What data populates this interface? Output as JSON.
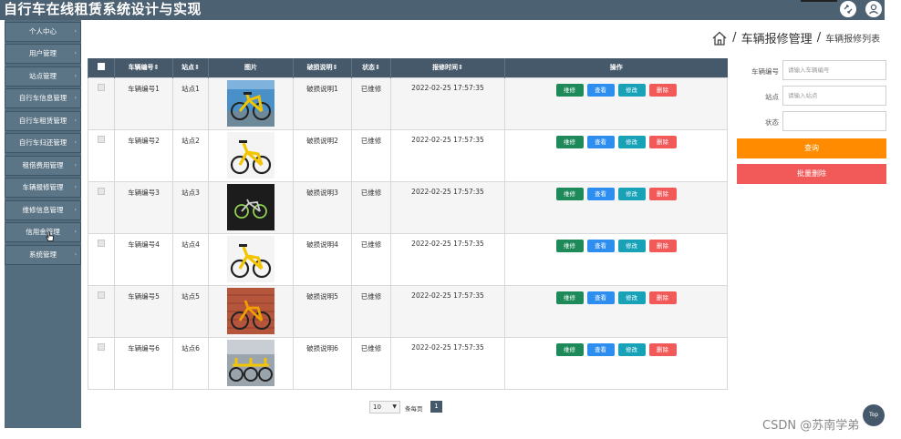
{
  "app": {
    "title": "自行车在线租赁系统设计与实现",
    "header_icons": [
      "fullscreen-exit-icon",
      "user-icon"
    ]
  },
  "sidebar": {
    "items": [
      {
        "label": "个人中心"
      },
      {
        "label": "用户管理"
      },
      {
        "label": "站点管理"
      },
      {
        "label": "自行车信息管理"
      },
      {
        "label": "自行车租赁管理"
      },
      {
        "label": "自行车归还管理"
      },
      {
        "label": "租借费用管理"
      },
      {
        "label": "车辆报修管理"
      },
      {
        "label": "维修信息管理"
      },
      {
        "label": "信用金管理"
      },
      {
        "label": "系统管理"
      }
    ]
  },
  "breadcrumb": {
    "section": "车辆报修管理",
    "separator": "/",
    "page": "车辆报修列表"
  },
  "table": {
    "columns": [
      "车辆编号",
      "站点",
      "图片",
      "破损说明",
      "状态",
      "报修时间",
      "操作"
    ],
    "actions": {
      "repair": "维修",
      "view": "查看",
      "edit": "修改",
      "delete": "删除"
    },
    "rows": [
      {
        "bike_no": "车辆编号1",
        "station": "站点1",
        "image": "yellow-bike-photo",
        "damage": "破损说明1",
        "status": "已维修",
        "time": "2022-02-25 17:57:35"
      },
      {
        "bike_no": "车辆编号2",
        "station": "站点2",
        "image": "yellow-bike-photo",
        "damage": "破损说明2",
        "status": "已维修",
        "time": "2022-02-25 17:57:35"
      },
      {
        "bike_no": "车辆编号3",
        "station": "站点3",
        "image": "dark-bike-photo",
        "damage": "破损说明3",
        "status": "已维修",
        "time": "2022-02-25 17:57:35"
      },
      {
        "bike_no": "车辆编号4",
        "station": "站点4",
        "image": "yellow-bike-photo",
        "damage": "破损说明4",
        "status": "已维修",
        "time": "2022-02-25 17:57:35"
      },
      {
        "bike_no": "车辆编号5",
        "station": "站点5",
        "image": "brick-wall-bike-photo",
        "damage": "破损说明5",
        "status": "已维修",
        "time": "2022-02-25 17:57:35"
      },
      {
        "bike_no": "车辆编号6",
        "station": "站点6",
        "image": "multi-seat-bike-photo",
        "damage": "破损说明6",
        "status": "已维修",
        "time": "2022-02-25 17:57:35"
      }
    ]
  },
  "pagination": {
    "page_size": "10",
    "per_page_label": "条每页",
    "current_page": "1"
  },
  "search": {
    "bike_no_label": "车辆编号",
    "bike_no_placeholder": "请输入车辆编号",
    "station_label": "站点",
    "station_placeholder": "请输入站点",
    "status_label": "状态",
    "status_value": "",
    "query_label": "查询",
    "batch_delete_label": "批量删除"
  },
  "colors": {
    "header_bg": "#4c6171",
    "sidebar_bg": "#536c7e",
    "table_header_bg": "#46596a",
    "repair_btn": "#1e8a5a",
    "view_btn": "#2e8ef0",
    "edit_btn": "#17a2b8",
    "delete_btn": "#f25a5a",
    "query_btn": "#ff8c00"
  },
  "watermark": "CSDN @苏南学弟",
  "back_to_top": "Top"
}
